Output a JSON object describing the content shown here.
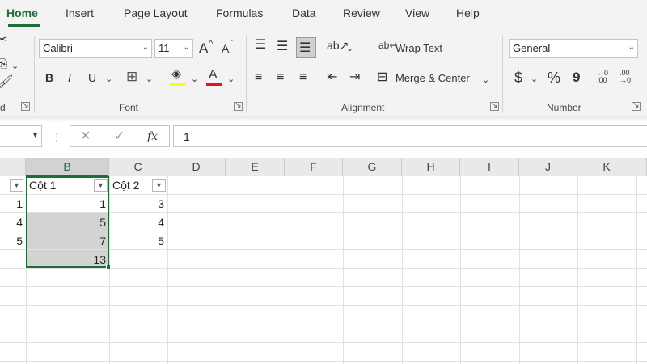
{
  "ribbon": {
    "tabs": [
      "Home",
      "Insert",
      "Page Layout",
      "Formulas",
      "Data",
      "Review",
      "View",
      "Help"
    ],
    "font": {
      "name": "Calibri",
      "size": "11",
      "bold": "B",
      "italic": "I",
      "underline": "U",
      "increase": "A",
      "decrease": "A",
      "color_letter": "A",
      "group_label": "Font"
    },
    "alignment": {
      "wrap_text": "Wrap Text",
      "merge_center": "Merge & Center",
      "group_label": "Alignment"
    },
    "number": {
      "format": "General",
      "currency": "$",
      "percent": "%",
      "comma": "9",
      "inc_decimal": "←0 .00",
      "dec_decimal": ".00 →0",
      "group_label": "Number"
    },
    "clipboard_partial_label": "d",
    "highlight_color": "#ffff00",
    "font_color": "#e81123"
  },
  "formula_bar": {
    "cancel": "✕",
    "enter": "✓",
    "fx": "fx",
    "value": "1"
  },
  "grid": {
    "columns": [
      "B",
      "C",
      "D",
      "E",
      "F",
      "G",
      "H",
      "I",
      "J",
      "K"
    ],
    "selected_column": "B",
    "headers": {
      "b": "Cột 1",
      "c": "Cột 2"
    },
    "col_a": [
      "1",
      "4",
      "5"
    ],
    "col_b": [
      "1",
      "5",
      "7",
      "13"
    ],
    "col_c": [
      "3",
      "4",
      "5"
    ],
    "accent": "#1e6b3c"
  }
}
